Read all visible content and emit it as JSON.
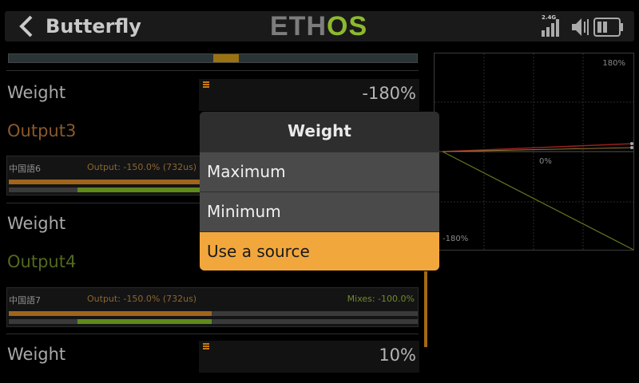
{
  "header": {
    "title": "Butterfly",
    "logo_left": "ETH",
    "logo_right": "OS",
    "signal_label": "2.4G"
  },
  "rows": [
    {
      "label": "Weight",
      "value": "-180%"
    },
    {
      "label": "Output3"
    },
    {
      "channel": "中国語6",
      "output": "Output: -150.0% (732us)",
      "mixes": ""
    },
    {
      "label": "Weight",
      "value": ""
    },
    {
      "label": "Output4"
    },
    {
      "channel": "中国語7",
      "output": "Output: -150.0% (732us)",
      "mixes": "Mixes: -100.0%"
    },
    {
      "label": "Weight",
      "value": "10%"
    }
  ],
  "curve": {
    "top_right": "180%",
    "center": "0%",
    "bottom_left": "-180%"
  },
  "dialog": {
    "title": "Weight",
    "options": [
      "Maximum",
      "Minimum",
      "Use a source"
    ],
    "selected_index": 2
  },
  "colors": {
    "accent": "#f2a73d",
    "output_bar": "#a0651c",
    "mix_bar": "#5f8a1c",
    "logo_green": "#8db92e"
  }
}
